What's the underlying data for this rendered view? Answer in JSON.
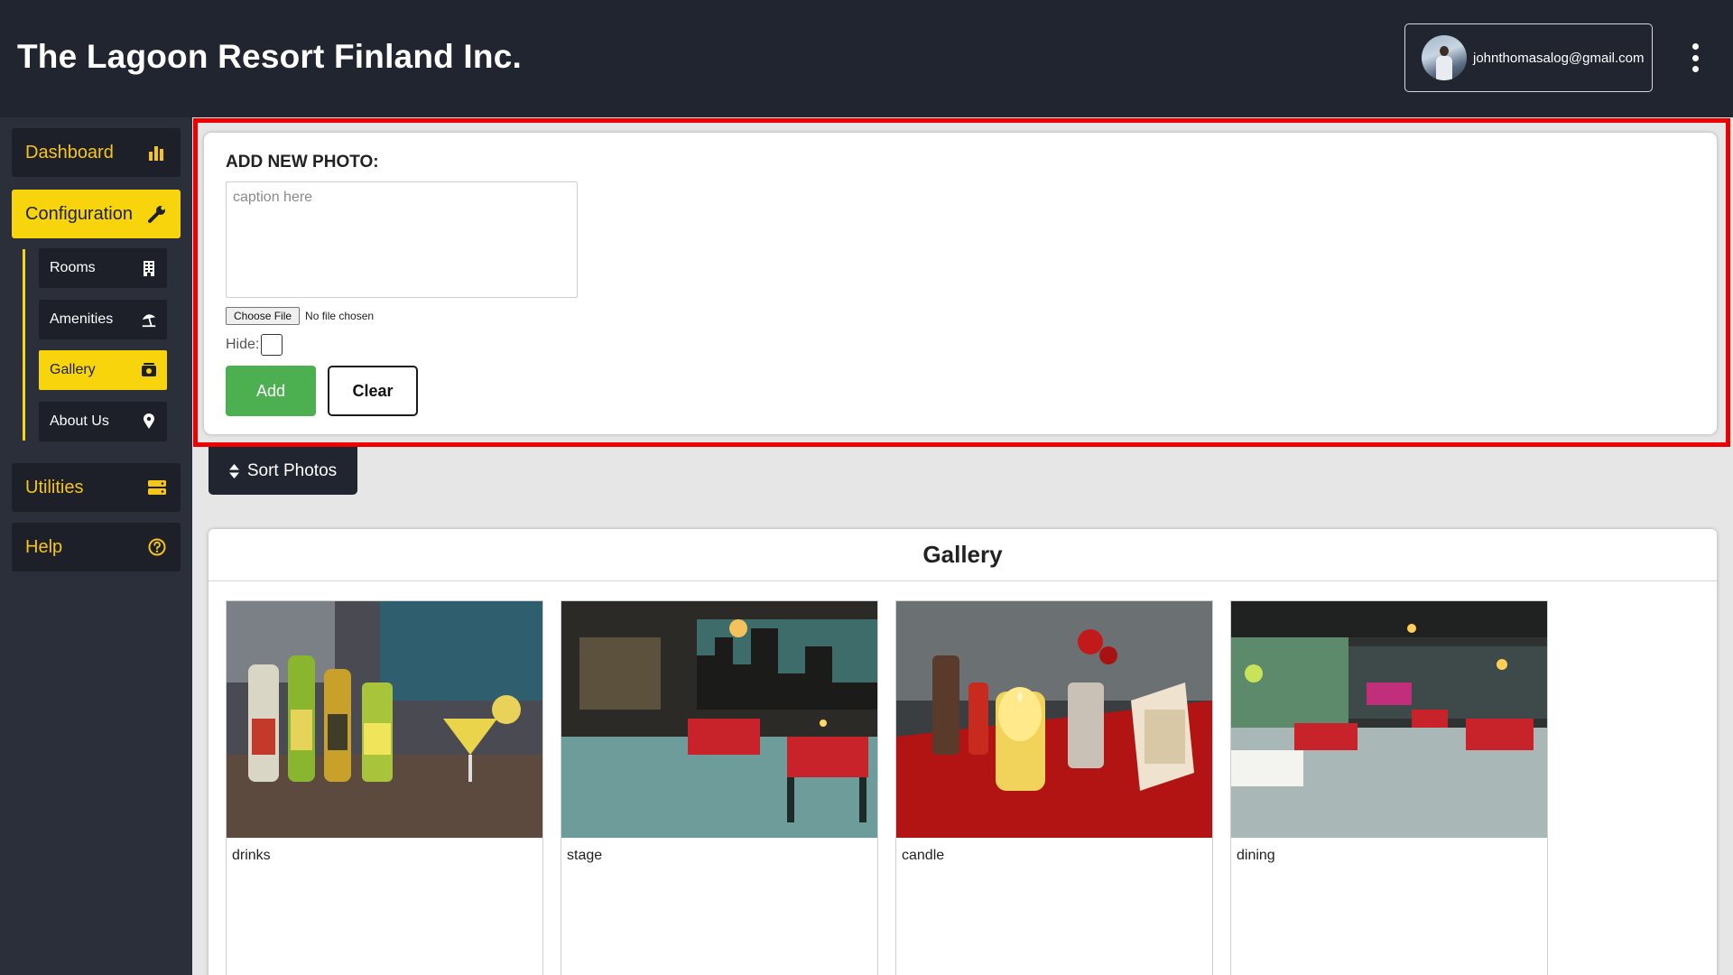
{
  "header": {
    "title": "The Lagoon Resort Finland Inc.",
    "user_email": "johnthomasalog@gmail.com"
  },
  "sidebar": {
    "items": [
      {
        "label": "Dashboard",
        "icon": "bar-chart-icon"
      },
      {
        "label": "Configuration",
        "icon": "wrench-icon",
        "active": true
      },
      {
        "label": "Utilities",
        "icon": "server-icon"
      },
      {
        "label": "Help",
        "icon": "question-circle-icon"
      }
    ],
    "sub_items": [
      {
        "label": "Rooms",
        "icon": "building-icon"
      },
      {
        "label": "Amenities",
        "icon": "umbrella-beach-icon"
      },
      {
        "label": "Gallery",
        "icon": "photo-album-icon",
        "active": true
      },
      {
        "label": "About Us",
        "icon": "map-pin-icon"
      }
    ]
  },
  "form": {
    "title": "ADD NEW PHOTO:",
    "caption_placeholder": "caption here",
    "caption_value": "",
    "file_button": "Choose File",
    "file_status": "No file chosen",
    "hide_label": "Hide:",
    "hide_checked": false,
    "add_label": "Add",
    "clear_label": "Clear"
  },
  "sort": {
    "label": "Sort Photos",
    "icon": "sort-icon"
  },
  "gallery": {
    "title": "Gallery",
    "photos": [
      {
        "caption": "drinks"
      },
      {
        "caption": "stage"
      },
      {
        "caption": "candle"
      },
      {
        "caption": "dining"
      }
    ]
  },
  "colors": {
    "header_bg": "#212530",
    "sidebar_bg": "#2b2f3a",
    "accent_yellow": "#f8d40c",
    "add_green": "#4caf50",
    "highlight_red": "#ee0000"
  }
}
